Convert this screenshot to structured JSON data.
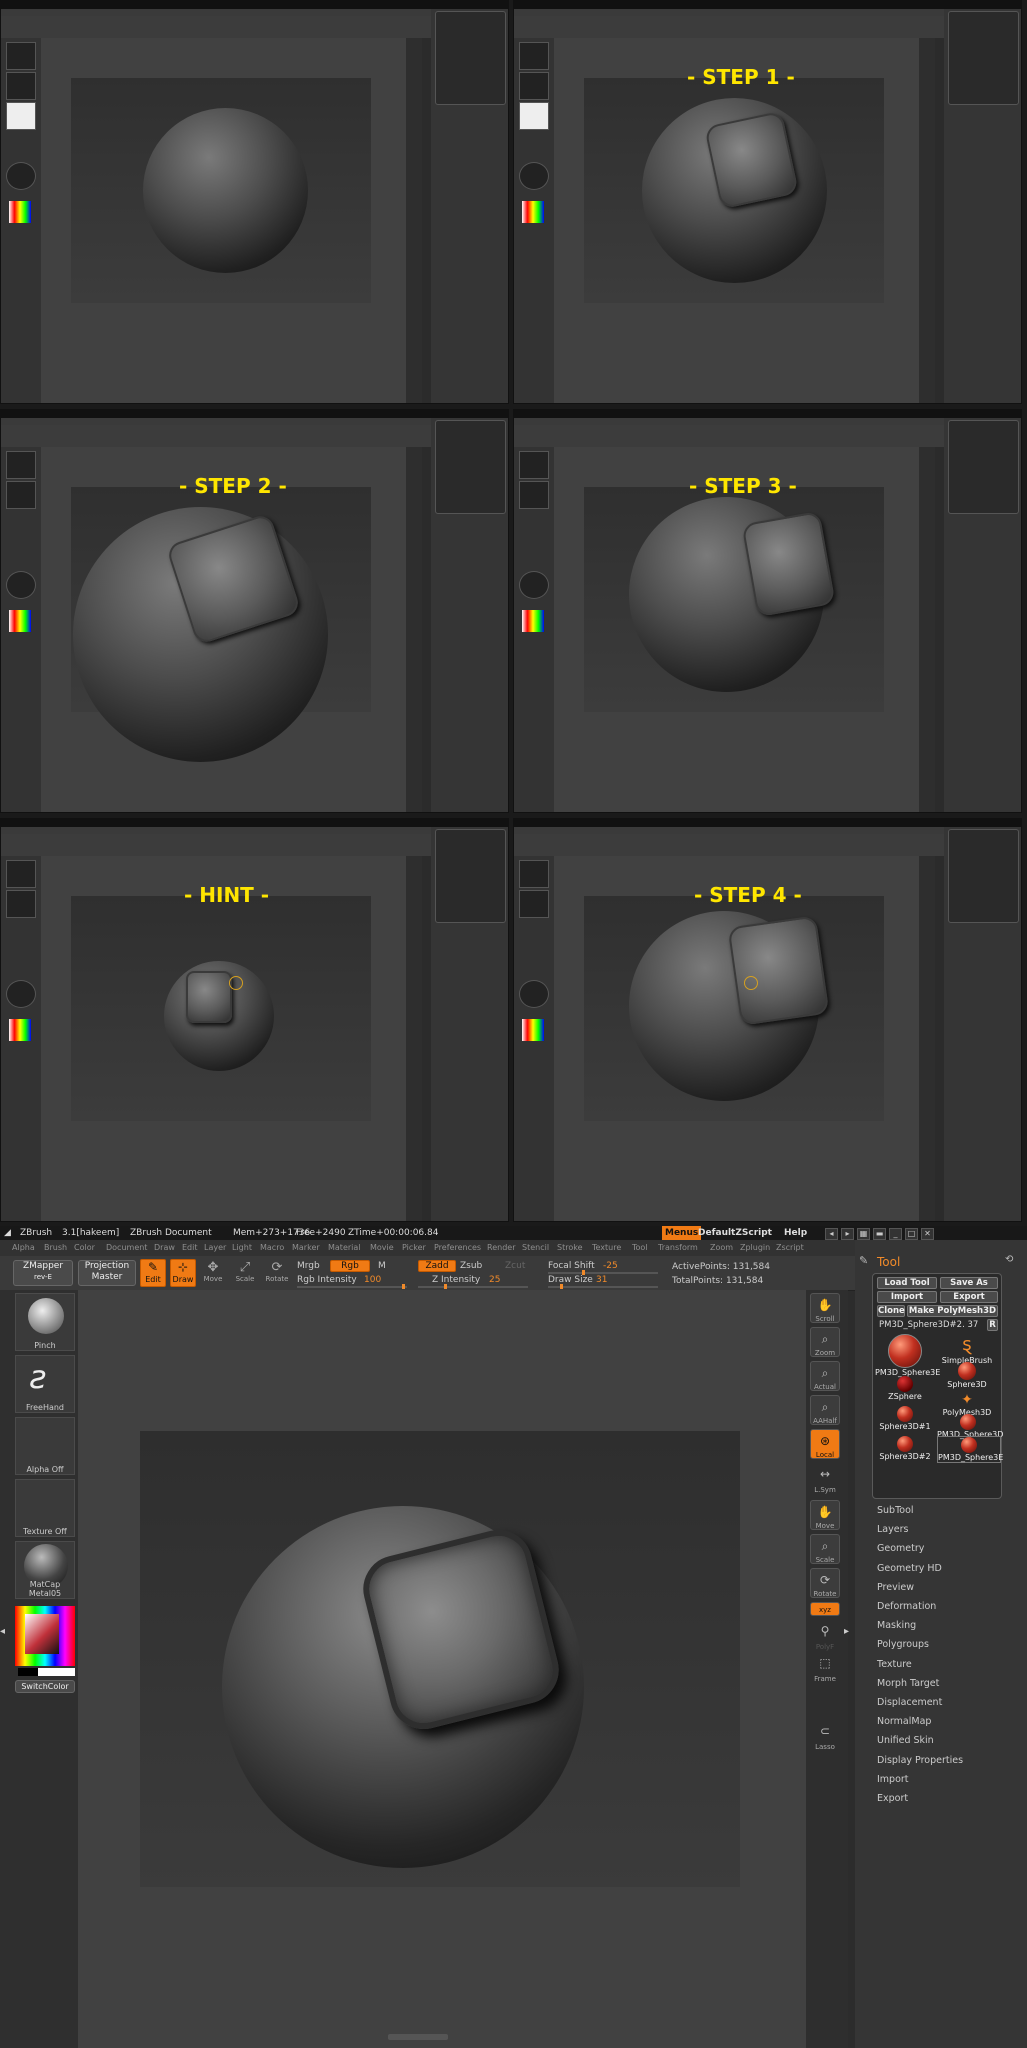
{
  "steps": {
    "step1": "- STEP 1 -",
    "step2": "- STEP 2 -",
    "step3": "- STEP 3 -",
    "hint": "- HINT -",
    "step4": "- STEP 4 -"
  },
  "titlebar": {
    "app": "ZBrush",
    "version": "3.1[hakeem]",
    "document": "ZBrush Document",
    "mem": "Mem+273+1736",
    "free": "Free+2490",
    "ztime": "ZTime+00:00:06.84",
    "menus": "Menus",
    "script": "DefaultZScript",
    "help": "Help"
  },
  "menubar": [
    "Alpha",
    "Brush",
    "Color",
    "Document",
    "Draw",
    "Edit",
    "Layer",
    "Light",
    "Macro",
    "Marker",
    "Material",
    "Movie",
    "Picker",
    "Preferences",
    "Render",
    "Stencil",
    "Stroke",
    "Texture",
    "Tool",
    "Transform",
    "Zoom",
    "Zplugin",
    "Zscript"
  ],
  "top_toolbar": {
    "zmapper": "ZMapper",
    "zmapper_sub": "rev-E",
    "projection": "Projection",
    "projection_sub": "Master",
    "edit": "Edit",
    "draw": "Draw",
    "move": "Move",
    "scale": "Scale",
    "rotate": "Rotate",
    "mrgb": "Mrgb",
    "rgb": "Rgb",
    "m": "M",
    "zadd": "Zadd",
    "zsub": "Zsub",
    "zcut": "Zcut",
    "rgb_intensity_label": "Rgb Intensity",
    "rgb_intensity_value": "100",
    "z_intensity_label": "Z Intensity",
    "z_intensity_value": "25",
    "focal_shift_label": "Focal Shift",
    "focal_shift_value": "-25",
    "draw_size_label": "Draw Size",
    "draw_size_value": "31",
    "active_points": "ActivePoints: 131,584",
    "total_points": "TotalPoints: 131,584"
  },
  "left_bar": {
    "brush": "Pinch",
    "stroke": "FreeHand",
    "alpha": "Alpha Off",
    "texture": "Texture Off",
    "material": "MatCap Metal05",
    "switch_color": "SwitchColor"
  },
  "right_shelf": [
    "Scroll",
    "Zoom",
    "Actual",
    "AAHalf",
    "Local",
    "L.Sym",
    "Move",
    "Scale",
    "Rotate",
    "PolyF",
    "Frame",
    "Lasso"
  ],
  "tool_palette": {
    "title": "Tool",
    "load_tool": "Load Tool",
    "save_as": "Save As",
    "import": "Import",
    "export": "Export",
    "clone": "Clone",
    "make_polymesh": "Make PolyMesh3D",
    "current_tool": "PM3D_Sphere3D#2. 37",
    "r": "R",
    "thumbs": [
      "PM3D_Sphere3E",
      "SimpleBrush",
      "Sphere3D",
      "ZSphere",
      "PolyMesh3D",
      "Sphere3D#1",
      "PM3D_Sphere3D",
      "Sphere3D#2",
      "PM3D_Sphere3E"
    ],
    "subpalettes": [
      "SubTool",
      "Layers",
      "Geometry",
      "Geometry HD",
      "Preview",
      "Deformation",
      "Masking",
      "Polygroups",
      "Texture",
      "Morph Target",
      "Displacement",
      "NormalMap",
      "Unified Skin",
      "Display Properties",
      "Import",
      "Export"
    ]
  },
  "colors": {
    "accent": "#f07a14",
    "label_yellow": "#ffe600",
    "canvas": "#414141"
  }
}
